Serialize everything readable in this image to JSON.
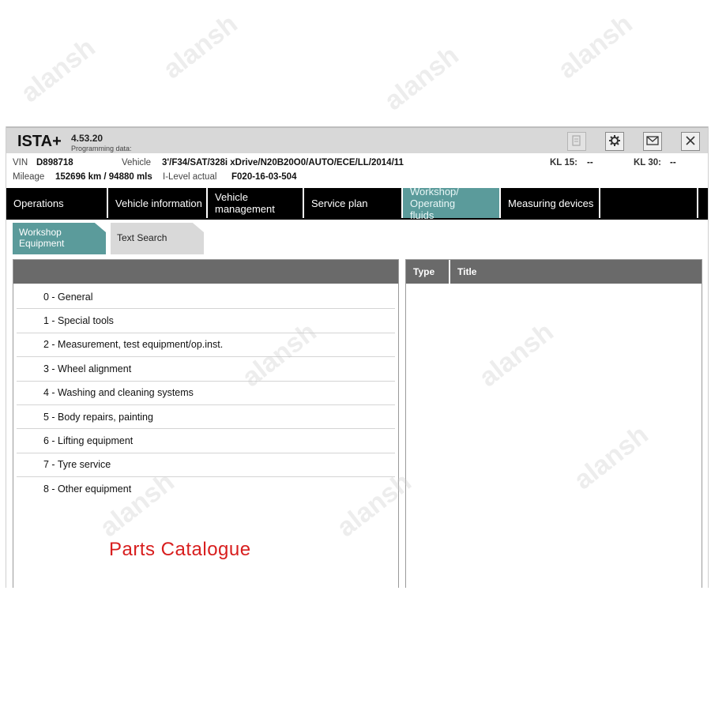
{
  "app": {
    "name": "ISTA+",
    "version": "4.53.20",
    "programming_label": "Programming data:"
  },
  "toolbar": {
    "icons": [
      "document-icon",
      "gear-icon",
      "mail-icon",
      "close-icon"
    ]
  },
  "vehicle_info": {
    "vin_label": "VIN",
    "vin": "D898718",
    "vehicle_label": "Vehicle",
    "vehicle": "3'/F34/SAT/328i xDrive/N20B20O0/AUTO/ECE/LL/2014/11",
    "mileage_label": "Mileage",
    "mileage": "152696 km / 94880 mls",
    "ilevel_label": "I-Level actual",
    "ilevel": "F020-16-03-504",
    "kl15_label": "KL 15:",
    "kl15": "--",
    "kl30_label": "KL 30:",
    "kl30": "--"
  },
  "nav": {
    "tabs": [
      {
        "label": "Operations"
      },
      {
        "label": "Vehicle information"
      },
      {
        "label": "Vehicle management"
      },
      {
        "label": "Service plan"
      },
      {
        "label": "Workshop/ Operating fluids",
        "active": true
      },
      {
        "label": "Measuring devices"
      }
    ]
  },
  "subtabs": [
    {
      "label": "Workshop Equipment",
      "active": true
    },
    {
      "label": "Text Search"
    }
  ],
  "categories": [
    "0 - General",
    "1 - Special tools",
    "2 - Measurement, test equipment/op.inst.",
    "3 - Wheel alignment",
    "4 - Washing and cleaning systems",
    "5 - Body repairs, painting",
    "6 - Lifting equipment",
    "7 - Tyre service",
    "8 - Other equipment"
  ],
  "results_table": {
    "columns": [
      "Type",
      "Title"
    ]
  },
  "overlay": {
    "caption": "Parts Catalogue",
    "watermark": "alansh"
  },
  "colors": {
    "accent": "#5b9b9b",
    "nav_bg": "#000000",
    "panel_header": "#6a6a6a",
    "caption": "#d81e1e"
  }
}
